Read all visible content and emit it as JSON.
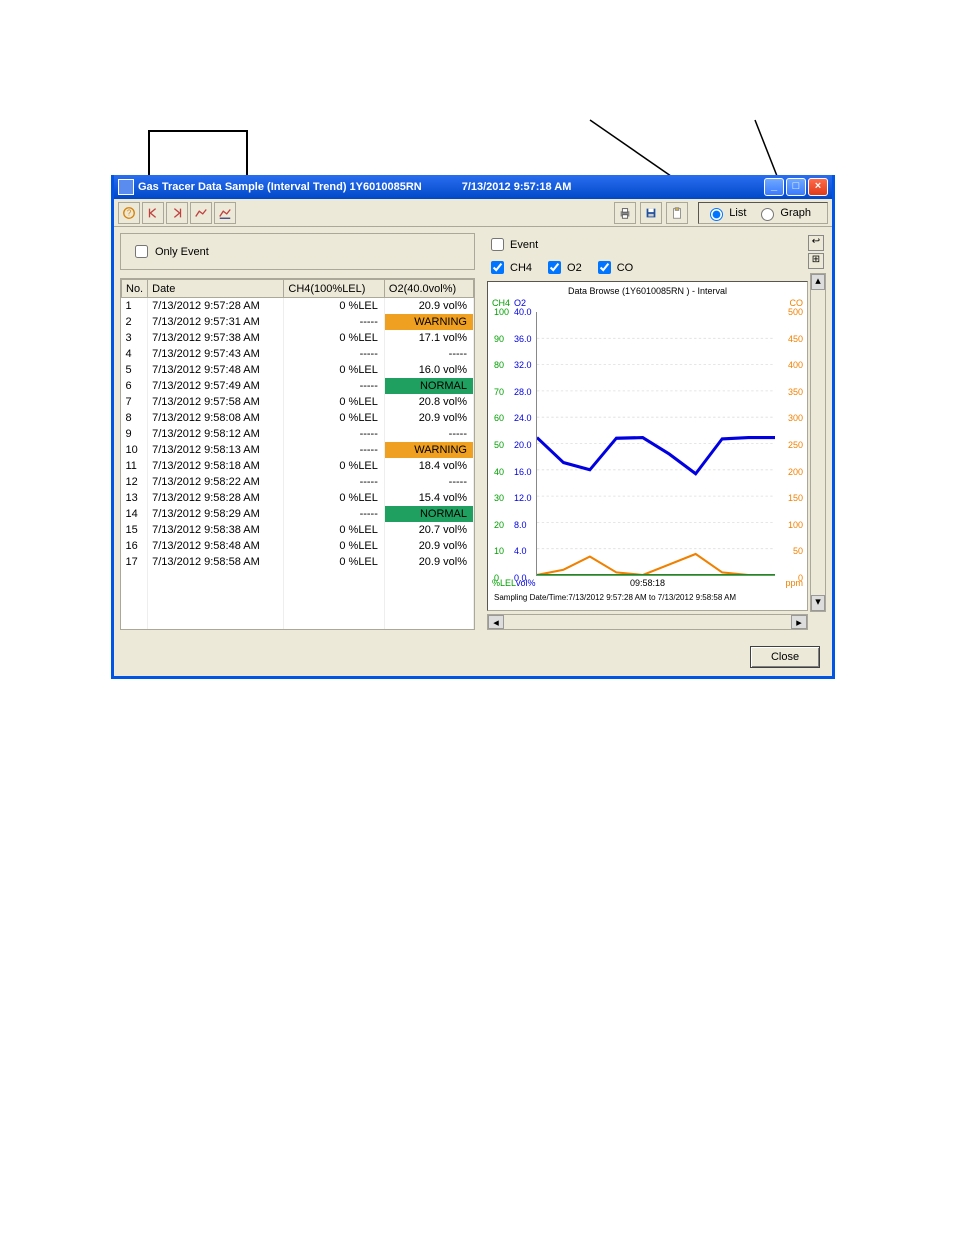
{
  "window": {
    "app_prefix": "Gas",
    "title": "Tracer Data Sample (Interval Trend) 1Y6010085RN",
    "title_date": "7/13/2012 9:57:18 AM"
  },
  "toolbar": {
    "view_list_label": "List",
    "view_graph_label": "Graph",
    "view_selected": "list"
  },
  "only_event_label": "Only Event",
  "table": {
    "headers": {
      "no": "No.",
      "date": "Date",
      "ch4": "CH4(100%LEL)",
      "o2": "O2(40.0vol%)"
    },
    "rows": [
      {
        "no": "1",
        "date": "7/13/2012 9:57:28 AM",
        "ch4": "0 %LEL",
        "o2": "20.9 vol%",
        "o2_status": ""
      },
      {
        "no": "2",
        "date": "7/13/2012 9:57:31 AM",
        "ch4": "-----",
        "o2": "WARNING",
        "o2_status": "warning"
      },
      {
        "no": "3",
        "date": "7/13/2012 9:57:38 AM",
        "ch4": "0 %LEL",
        "o2": "17.1 vol%",
        "o2_status": ""
      },
      {
        "no": "4",
        "date": "7/13/2012 9:57:43 AM",
        "ch4": "-----",
        "o2": "-----",
        "o2_status": ""
      },
      {
        "no": "5",
        "date": "7/13/2012 9:57:48 AM",
        "ch4": "0 %LEL",
        "o2": "16.0 vol%",
        "o2_status": ""
      },
      {
        "no": "6",
        "date": "7/13/2012 9:57:49 AM",
        "ch4": "-----",
        "o2": "NORMAL",
        "o2_status": "normal"
      },
      {
        "no": "7",
        "date": "7/13/2012 9:57:58 AM",
        "ch4": "0 %LEL",
        "o2": "20.8 vol%",
        "o2_status": ""
      },
      {
        "no": "8",
        "date": "7/13/2012 9:58:08 AM",
        "ch4": "0 %LEL",
        "o2": "20.9 vol%",
        "o2_status": ""
      },
      {
        "no": "9",
        "date": "7/13/2012 9:58:12 AM",
        "ch4": "-----",
        "o2": "-----",
        "o2_status": ""
      },
      {
        "no": "10",
        "date": "7/13/2012 9:58:13 AM",
        "ch4": "-----",
        "o2": "WARNING",
        "o2_status": "warning"
      },
      {
        "no": "11",
        "date": "7/13/2012 9:58:18 AM",
        "ch4": "0 %LEL",
        "o2": "18.4 vol%",
        "o2_status": ""
      },
      {
        "no": "12",
        "date": "7/13/2012 9:58:22 AM",
        "ch4": "-----",
        "o2": "-----",
        "o2_status": ""
      },
      {
        "no": "13",
        "date": "7/13/2012 9:58:28 AM",
        "ch4": "0 %LEL",
        "o2": "15.4 vol%",
        "o2_status": ""
      },
      {
        "no": "14",
        "date": "7/13/2012 9:58:29 AM",
        "ch4": "-----",
        "o2": "NORMAL",
        "o2_status": "normal"
      },
      {
        "no": "15",
        "date": "7/13/2012 9:58:38 AM",
        "ch4": "0 %LEL",
        "o2": "20.7 vol%",
        "o2_status": ""
      },
      {
        "no": "16",
        "date": "7/13/2012 9:58:48 AM",
        "ch4": "0 %LEL",
        "o2": "20.9 vol%",
        "o2_status": ""
      },
      {
        "no": "17",
        "date": "7/13/2012 9:58:58 AM",
        "ch4": "0 %LEL",
        "o2": "20.9 vol%",
        "o2_status": ""
      }
    ]
  },
  "checkboxes": {
    "event_label": "Event",
    "ch4_label": "CH4",
    "o2_label": "O2",
    "co_label": "CO"
  },
  "chart": {
    "title": "Data Browse (1Y6010085RN         ) - Interval",
    "ch4_header": "CH4",
    "o2_header": "O2",
    "co_header": "CO",
    "left_unit": "%LEL",
    "left2_unit": "vol%",
    "right_unit": "ppm",
    "x_tick": "09:58:18",
    "footer": "Sampling Date/Time:7/13/2012 9:57:28 AM to 7/13/2012 9:58:58 AM"
  },
  "chart_data": {
    "type": "line",
    "x": [
      "9:57:28",
      "9:57:38",
      "9:57:48",
      "9:57:58",
      "9:58:08",
      "9:58:18",
      "9:58:28",
      "9:58:38",
      "9:58:48",
      "9:58:58"
    ],
    "series": [
      {
        "name": "CH4",
        "color": "#00a000",
        "unit": "%LEL",
        "axis_range": [
          0,
          100
        ],
        "ticks": [
          0,
          10,
          20,
          30,
          40,
          50,
          60,
          70,
          80,
          90,
          100
        ],
        "values": [
          0,
          0,
          0,
          0,
          0,
          0,
          0,
          0,
          0,
          0
        ]
      },
      {
        "name": "O2",
        "color": "#0000e0",
        "unit": "vol%",
        "axis_range": [
          0,
          40
        ],
        "ticks": [
          0.0,
          4.0,
          8.0,
          12.0,
          16.0,
          20.0,
          24.0,
          28.0,
          32.0,
          36.0,
          40.0
        ],
        "values": [
          20.9,
          17.1,
          16.0,
          20.8,
          20.9,
          18.4,
          15.4,
          20.7,
          20.9,
          20.9
        ]
      },
      {
        "name": "CO",
        "color": "#f08000",
        "unit": "ppm",
        "axis_range": [
          0,
          500
        ],
        "ticks": [
          0,
          50,
          100,
          150,
          200,
          250,
          300,
          350,
          400,
          450,
          500
        ],
        "values": [
          0,
          10,
          35,
          5,
          0,
          20,
          40,
          5,
          0,
          0
        ]
      }
    ]
  },
  "close_button": "Close"
}
